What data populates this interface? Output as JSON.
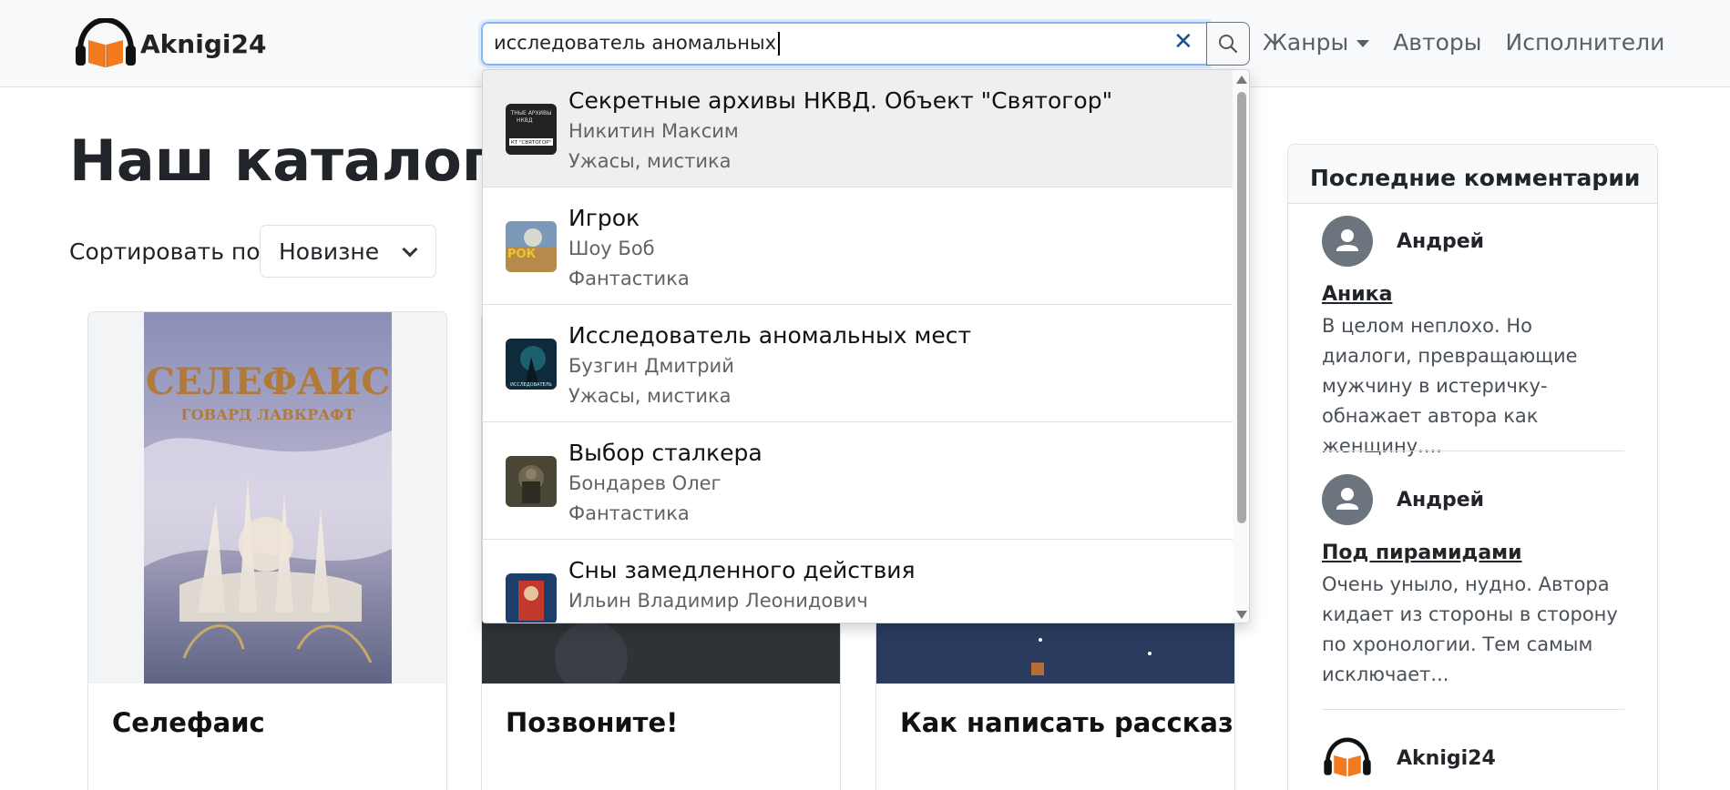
{
  "brand": {
    "name": "Aknigi24",
    "accent": "#f47a20"
  },
  "search": {
    "value": "исследователь аномальных",
    "clear_icon": "close-icon",
    "button_icon": "search-icon"
  },
  "nav": {
    "genres": "Жанры",
    "authors": "Авторы",
    "performers": "Исполнители"
  },
  "main": {
    "title": "Наш каталог ау",
    "sort_label": "Сортировать по:",
    "sort_value": "Новизне"
  },
  "cards": [
    {
      "title": "Селефаис",
      "cover_title": "СЕЛЕФАИС",
      "cover_author": "ГОВАРД ЛАВКРАФТ"
    },
    {
      "title": "Позвоните!"
    },
    {
      "title": "Как написать рассказ"
    }
  ],
  "suggestions": [
    {
      "title": "Секретные архивы НКВД. Объект \"Святогор\"",
      "author": "Никитин Максим",
      "genre": "Ужасы, мистика",
      "thumb_text": "ТНЫЕ АРХИВЫ НКВД КТ \"СВЯТОГОР\""
    },
    {
      "title": "Игрок",
      "author": "Шоу Боб",
      "genre": "Фантастика",
      "thumb_text": "РОК"
    },
    {
      "title": "Исследователь аномальных мест",
      "author": "Бузгин Дмитрий",
      "genre": "Ужасы, мистика",
      "thumb_text": "ИССЛЕДОВАТЕЛЬ"
    },
    {
      "title": "Выбор сталкера",
      "author": "Бондарев Олег",
      "genre": "Фантастика"
    },
    {
      "title": "Сны замедленного действия",
      "author": "Ильин Владимир Леонидович"
    }
  ],
  "sidebar": {
    "title": "Последние комментарии",
    "comments": [
      {
        "user": "Андрей",
        "book": "Аника",
        "text": "В целом неплохо. Но диалоги, превращающие мужчину в истеричку-обнажает автора как женщину...."
      },
      {
        "user": "Андрей",
        "book": "Под пирамидами",
        "text": "Очень уныло, нудно. Автора кидает из стороны в сторону по хронологии. Тем самым исключает..."
      },
      {
        "user": "Aknigi24"
      }
    ]
  }
}
